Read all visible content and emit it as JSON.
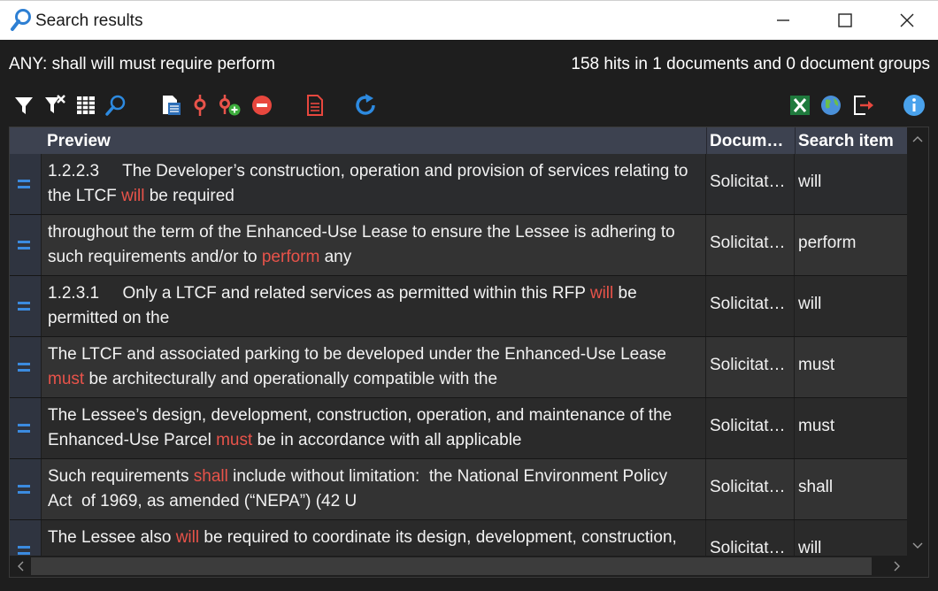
{
  "window": {
    "title": "Search results"
  },
  "summary": {
    "query": "ANY: shall will must require perform",
    "hits": "158 hits in 1 documents and 0 document groups"
  },
  "table": {
    "columns": [
      "Preview",
      "Docum…",
      "Search item"
    ],
    "rows": [
      {
        "before": "1.2.2.3     The Developer’s construction, operation and provision of services relating to the LTCF ",
        "hit": "will",
        "after": " be required",
        "doc": "Solicitat…",
        "item": "will"
      },
      {
        "before": "throughout the term of the Enhanced-Use Lease to ensure the Lessee is adhering to such requirements and/or to ",
        "hit": "perform",
        "after": " any",
        "doc": "Solicitat…",
        "item": "perform"
      },
      {
        "before": "1.2.3.1     Only a LTCF and related services as permitted within this RFP ",
        "hit": "will",
        "after": " be permitted on the",
        "doc": "Solicitat…",
        "item": "will"
      },
      {
        "before": "The LTCF and associated parking to be developed under the Enhanced-Use Lease ",
        "hit": "must",
        "after": " be architecturally and operationally compatible with the",
        "doc": "Solicitat…",
        "item": "must"
      },
      {
        "before": "The Lessee’s design, development, construction, operation, and maintenance of the Enhanced-Use Parcel ",
        "hit": "must",
        "after": " be in accordance with all applicable",
        "doc": "Solicitat…",
        "item": "must"
      },
      {
        "before": "Such requirements ",
        "hit": "shall",
        "after": " include without limitation:  the National Environment Policy Act  of 1969, as amended (“NEPA”) (42 U",
        "doc": "Solicitat…",
        "item": "shall"
      },
      {
        "before": "The Lessee also ",
        "hit": "will",
        "after": " be required to coordinate its design, development, construction,",
        "doc": "Solicitat…",
        "item": "will"
      }
    ]
  },
  "icons": {
    "title": "magnifier-icon",
    "toolbar": [
      "filter-icon",
      "clear-filter-icon",
      "columns-icon",
      "search-icon",
      "document-list-icon",
      "red-pin-icon",
      "add-pin-icon",
      "remove-icon",
      "report-icon",
      "refresh-icon",
      "excel-icon",
      "globe-icon",
      "export-icon",
      "info-icon"
    ]
  },
  "colors": {
    "highlight": "#e8534a",
    "accent": "#3b8be0",
    "header": "#3d4250"
  }
}
